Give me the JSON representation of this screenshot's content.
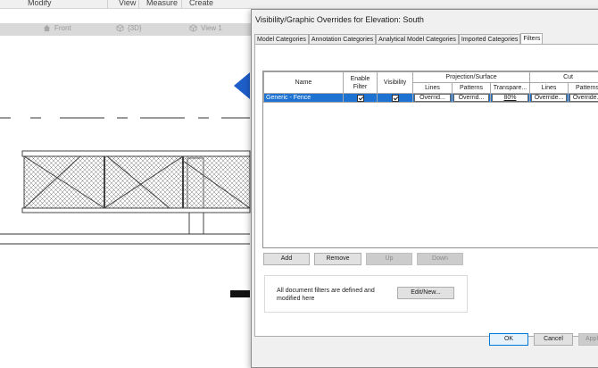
{
  "menu": {
    "items": [
      "Modify",
      "View",
      "Measure",
      "Create"
    ]
  },
  "view_tabs": [
    {
      "label": "Front",
      "icon": "home-icon"
    },
    {
      "label": "{3D}",
      "icon": "cube-icon"
    },
    {
      "label": "View 1",
      "icon": "cube-icon"
    }
  ],
  "dialog": {
    "title": "Visibility/Graphic Overrides for Elevation: South",
    "tabs": [
      "Model Categories",
      "Annotation Categories",
      "Analytical Model Categories",
      "Imported Categories",
      "Filters"
    ],
    "active_tab": "Filters",
    "table": {
      "headers": {
        "name": "Name",
        "enable_filter": "Enable Filter",
        "visibility": "Visibility",
        "projection_group": "Projection/Surface",
        "cut_group": "Cut",
        "lines": "Lines",
        "patterns": "Patterns",
        "transparency": "Transpare...",
        "cut_lines": "Lines",
        "cut_patterns": "Patterns"
      },
      "rows": [
        {
          "name": "Generic - Fence",
          "enable_filter": true,
          "visibility": true,
          "proj_lines": "Overrid...",
          "proj_patterns": "Overrid...",
          "transparency": "80%",
          "cut_lines": "Override...",
          "cut_patterns": "Override..."
        }
      ]
    },
    "buttons": {
      "add": "Add",
      "remove": "Remove",
      "up": "Up",
      "down": "Down",
      "edit_new": "Edit/New...",
      "ok": "OK",
      "cancel": "Cancel",
      "apply": "Appl"
    },
    "info_text": "All document filters are defined and modified here"
  }
}
